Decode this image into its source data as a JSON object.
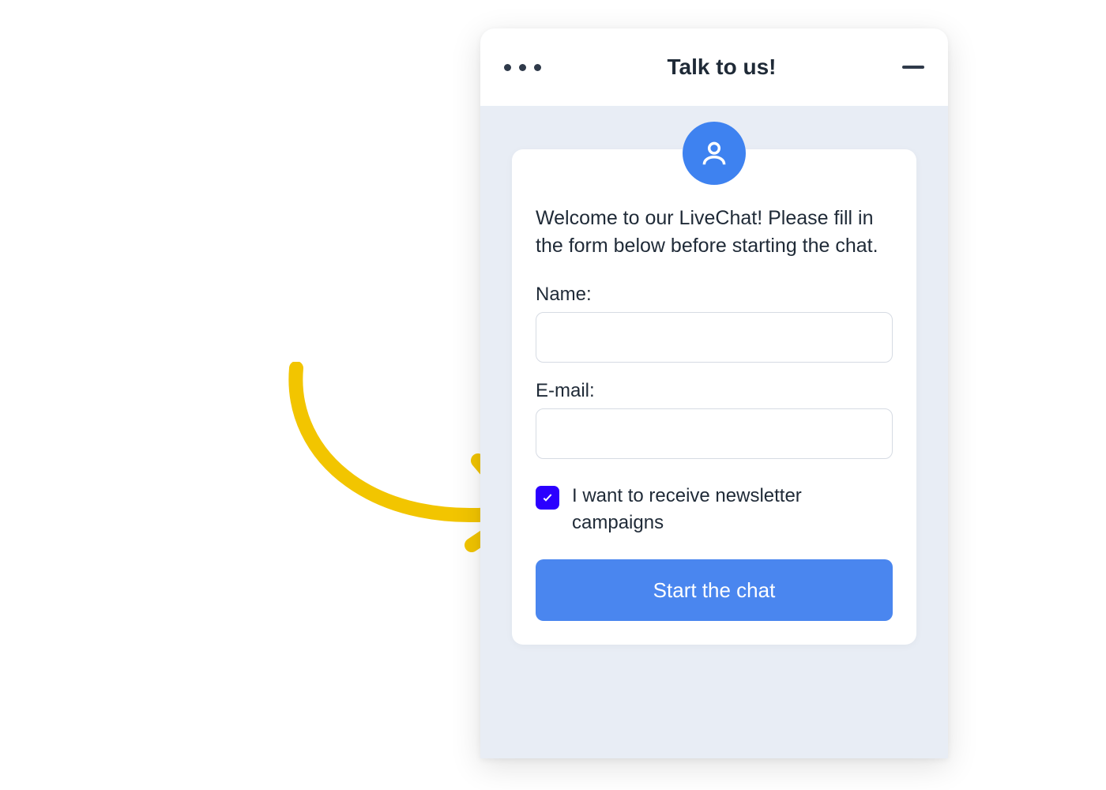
{
  "header": {
    "title": "Talk to us!"
  },
  "form": {
    "welcome": "Welcome to our LiveChat! Please fill in the form below before starting the chat.",
    "name_label": "Name:",
    "name_value": "",
    "email_label": "E-mail:",
    "email_value": "",
    "newsletter_label": "I want to receive newsletter campaigns",
    "newsletter_checked": true,
    "submit_label": "Start the chat"
  },
  "icons": {
    "avatar": "person-icon",
    "menu": "more-horizontal-icon",
    "minimize": "minimize-icon",
    "check": "check-icon",
    "arrow": "curved-arrow-icon"
  },
  "colors": {
    "primary": "#4a86ef",
    "checkbox": "#2b00ff",
    "annotation": "#f2c500",
    "body_bg": "#e8edf5",
    "text": "#1f2a37"
  }
}
